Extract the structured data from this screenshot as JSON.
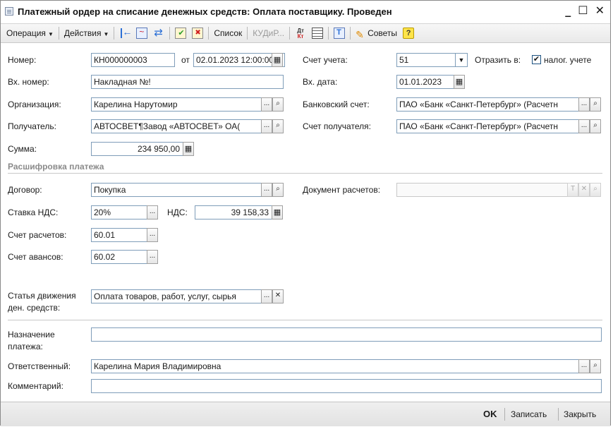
{
  "window": {
    "title": "Платежный ордер на списание денежных средств: Оплата поставщику. Проведен",
    "controls": {
      "minimize": "_",
      "maximize": "☐",
      "close": "✕"
    }
  },
  "toolbar": {
    "operation": "Операция",
    "actions": "Действия",
    "list": "Список",
    "kudir": "КУДиР...",
    "hints": "Советы",
    "help": "?",
    "dtkt_dt": "Дт",
    "dtkt_kt": "Кт"
  },
  "form": {
    "number_label": "Номер:",
    "number_value": "КН000000003",
    "from_label": "от",
    "date_value": "02.01.2023 12:00:00",
    "account_label": "Счет учета:",
    "account_value": "51",
    "reflect_label": "Отразить в:",
    "tax_checked": "✔",
    "tax_label": "налог. учете",
    "in_number_label": "Вх. номер:",
    "in_number_value": "Накладная №!",
    "in_date_label": "Вх. дата:",
    "in_date_value": "01.01.2023",
    "org_label": "Организация:",
    "org_value": "Карелина Нарутомир",
    "bank_account_label": "Банковский счет:",
    "bank_account_value": "ПАО «Банк «Санкт-Петербург» (Расчетн",
    "recipient_label": "Получатель:",
    "recipient_value": "АВТОСВЕТ¶Завод «АВТОСВЕТ» ОА(",
    "recipient_account_label": "Счет получателя:",
    "recipient_account_value": "ПАО «Банк «Санкт-Петербург» (Расчетн",
    "sum_label": "Сумма:",
    "sum_value": "234 950,00",
    "section_title": "Расшифровка платежа",
    "contract_label": "Договор:",
    "contract_value": "Покупка",
    "settlement_doc_label": "Документ расчетов:",
    "settlement_doc_value": "",
    "vat_rate_label": "Ставка НДС:",
    "vat_rate_value": "20%",
    "vat_label": "НДС:",
    "vat_value": "39 158,33",
    "settlement_account_label": "Счет расчетов:",
    "settlement_account_value": "60.01",
    "advance_account_label": "Счет авансов:",
    "advance_account_value": "60.02",
    "cashflow_label_1": "Статья движения",
    "cashflow_label_2": "ден. средств:",
    "cashflow_value": "Оплата товаров, работ, услуг, сырья",
    "purpose_label_1": "Назначение",
    "purpose_label_2": "платежа:",
    "purpose_value": "",
    "responsible_label": "Ответственный:",
    "responsible_value": "Карелина Мария Владимировна",
    "comment_label": "Комментарий:",
    "comment_value": "",
    "dots": "...",
    "search": "🔍",
    "clear": "✕",
    "t": "T"
  },
  "bottom": {
    "ok": "OK",
    "save": "Записать",
    "close": "Закрыть"
  }
}
